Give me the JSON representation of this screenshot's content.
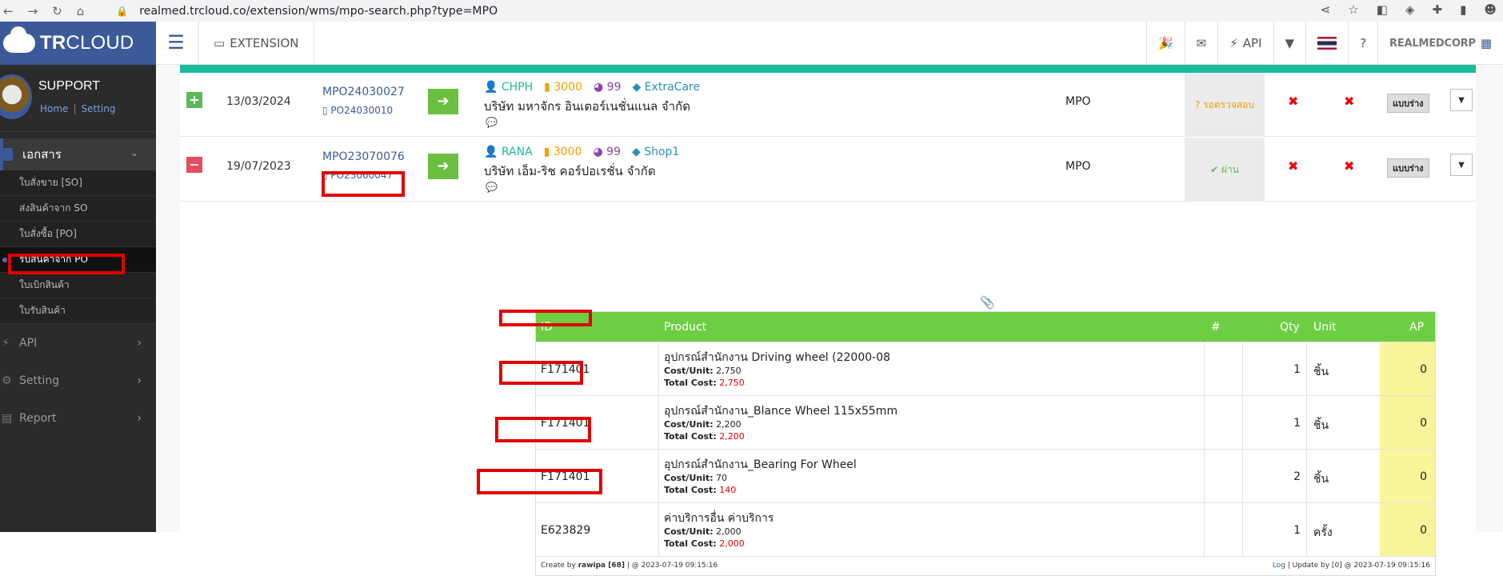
{
  "browser": {
    "url": "realmed.trcloud.co/extension/wms/mpo-search.php?type=MPO"
  },
  "brand": {
    "name_bold": "TR",
    "name_light": "CLOUD"
  },
  "topbar": {
    "extension_label": "EXTENSION",
    "api_label": "API",
    "company": "REALMEDCORP"
  },
  "sidebar": {
    "user": "SUPPORT",
    "home_link": "Home",
    "setting_link": "Setting",
    "section": "เอกสาร",
    "items": [
      {
        "label": "ใบสั่งขาย [SO]"
      },
      {
        "label": "ส่งสินค้าจาก SO"
      },
      {
        "label": "ใบสั่งซื้อ [PO]"
      },
      {
        "label": "รับสินค้าจาก PO"
      },
      {
        "label": "ใบเบิกสินค้า"
      },
      {
        "label": "ใบรับสินค้า"
      }
    ],
    "menus": [
      {
        "label": "API"
      },
      {
        "label": "Setting"
      },
      {
        "label": "Report"
      }
    ]
  },
  "rows": [
    {
      "toggle": "+",
      "date": "13/03/2024",
      "mpo": "MPO24030027",
      "po": "PO24030010",
      "user": "CHPH",
      "warehouse": "3000",
      "branch": "99",
      "project": "ExtraCare",
      "company": "บริษัท มหาจักร อินเตอร์เนชั่นแนล จำกัด",
      "type": "MPO",
      "status": "รอตรวจสอบ",
      "draft": "แบบร่าง"
    },
    {
      "toggle": "−",
      "date": "19/07/2023",
      "mpo": "MPO23070076",
      "po": "PO23060047",
      "user": "RANA",
      "warehouse": "3000",
      "branch": "99",
      "project": "Shop1",
      "company": "บริษัท เอ็ม-ริช คอร์ปอเรชั่น จำกัด",
      "type": "MPO",
      "status": "ผ่าน",
      "draft": "แบบร่าง"
    }
  ],
  "detail": {
    "headers": {
      "id": "ID",
      "product": "Product",
      "hash": "#",
      "qty": "Qty",
      "unit": "Unit",
      "ap": "AP"
    },
    "items": [
      {
        "id": "F171401",
        "product": "อุปกรณ์สำนักงาน Driving wheel (22000-08",
        "cost_label": "Cost/Unit:",
        "cost": "2,750",
        "total_label": "Total Cost:",
        "total": "2,750",
        "qty": "1",
        "unit": "ชิ้น",
        "ap": "0"
      },
      {
        "id": "F171401",
        "product": "อุปกรณ์สำนักงาน_Blance Wheel 115x55mm",
        "cost_label": "Cost/Unit:",
        "cost": "2,200",
        "total_label": "Total Cost:",
        "total": "2,200",
        "qty": "1",
        "unit": "ชิ้น",
        "ap": "0"
      },
      {
        "id": "F171401",
        "product": "อุปกรณ์สำนักงาน_Bearing For Wheel",
        "cost_label": "Cost/Unit:",
        "cost": "70",
        "total_label": "Total Cost:",
        "total": "140",
        "qty": "2",
        "unit": "ชิ้น",
        "ap": "0"
      },
      {
        "id": "E623829",
        "product": "ค่าบริการอื่น ค่าบริการ",
        "cost_label": "Cost/Unit:",
        "cost": "2,000",
        "total_label": "Total Cost:",
        "total": "2,000",
        "qty": "1",
        "unit": "ครั้ง",
        "ap": "0"
      }
    ],
    "footer_left_prefix": "Create by",
    "footer_left_user": "rawipa [68]",
    "footer_left_time": "| @ 2023-07-19 09:15:16",
    "footer_log": "Log",
    "footer_right": "| Update by [0] @ 2023-07-19 09:15:16"
  }
}
